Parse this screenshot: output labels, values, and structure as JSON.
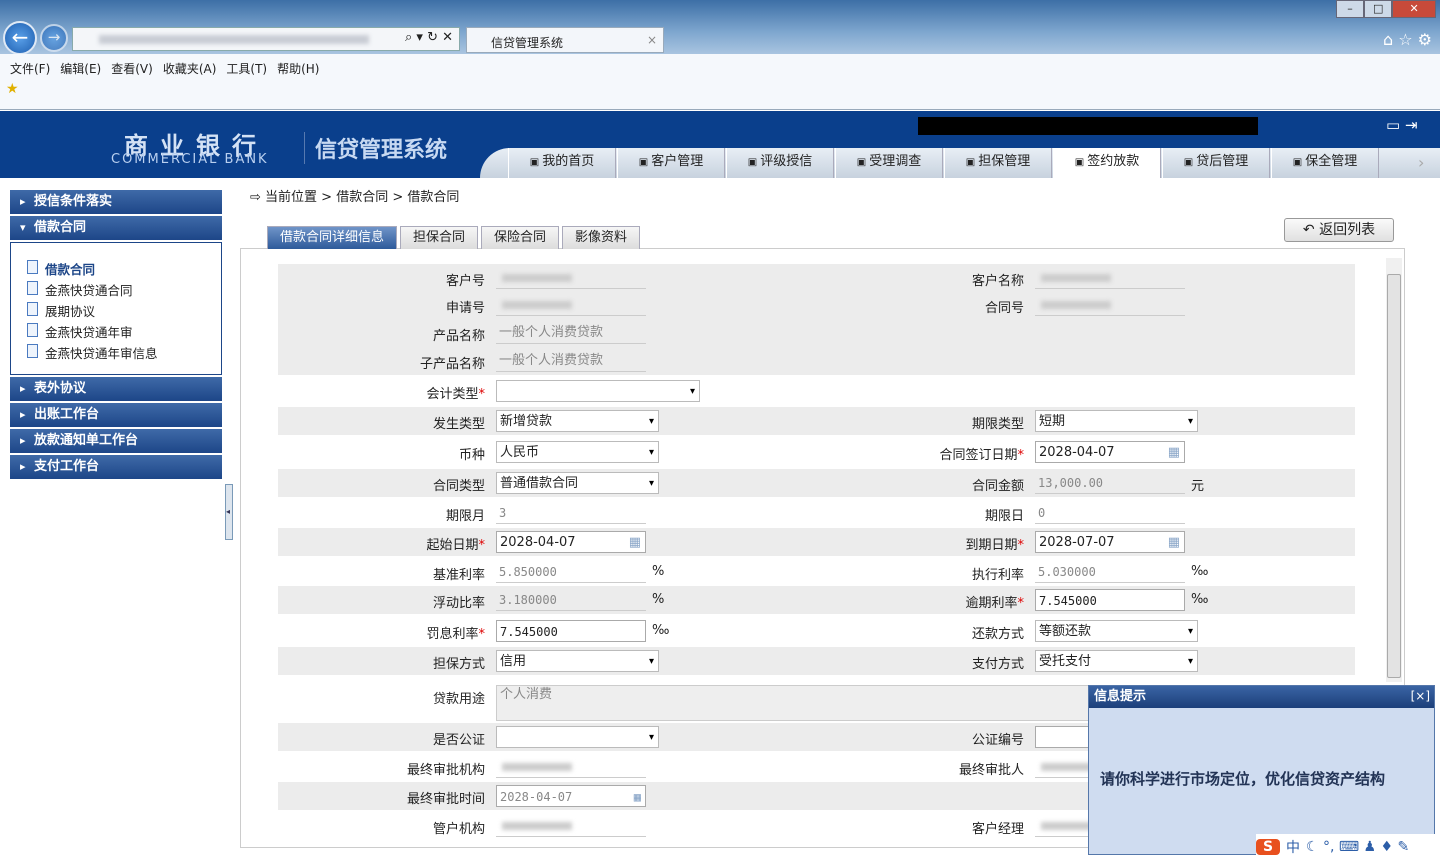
{
  "browser": {
    "tab_title": "信贷管理系统",
    "menu": [
      "文件(F)",
      "编辑(E)",
      "查看(V)",
      "收藏夹(A)",
      "工具(T)",
      "帮助(H)"
    ]
  },
  "header": {
    "bank_cn": "商业银行",
    "bank_en": "COMMERCIAL BANK",
    "system": "信贷管理系统"
  },
  "nav": [
    {
      "label": "我的首页",
      "icon": "home-icon"
    },
    {
      "label": "客户管理",
      "icon": "customer-icon"
    },
    {
      "label": "评级授信",
      "icon": "rating-icon"
    },
    {
      "label": "受理调查",
      "icon": "survey-icon"
    },
    {
      "label": "担保管理",
      "icon": "guarantee-icon"
    },
    {
      "label": "签约放款",
      "icon": "contract-icon",
      "active": true
    },
    {
      "label": "贷后管理",
      "icon": "postloan-icon"
    },
    {
      "label": "保全管理",
      "icon": "preserve-icon"
    }
  ],
  "sidebar": {
    "groups": [
      {
        "label": "授信条件落实"
      },
      {
        "label": "借款合同",
        "open": true,
        "items": [
          "借款合同",
          "金燕快贷通合同",
          "展期协议",
          "金燕快贷通年审",
          "金燕快贷通年审信息"
        ]
      },
      {
        "label": "表外协议"
      },
      {
        "label": "出账工作台"
      },
      {
        "label": "放款通知单工作台"
      },
      {
        "label": "支付工作台"
      }
    ]
  },
  "breadcrumb": "当前位置 > 借款合同 > 借款合同",
  "tabs": [
    "借款合同详细信息",
    "担保合同",
    "保险合同",
    "影像资料"
  ],
  "back_button": "返回列表",
  "form": [
    {
      "l": {
        "label": "客户号",
        "type": "blur"
      },
      "r": {
        "label": "客户名称",
        "type": "blur"
      }
    },
    {
      "l": {
        "label": "申请号",
        "type": "blur"
      },
      "r": {
        "label": "合同号",
        "type": "blur"
      }
    },
    {
      "l": {
        "label": "产品名称",
        "value": "一般个人消费贷款"
      }
    },
    {
      "l": {
        "label": "子产品名称",
        "value": "一般个人消费贷款"
      }
    },
    {
      "l": {
        "label": "会计类型",
        "req": true,
        "type": "sel",
        "value": ""
      }
    },
    {
      "l": {
        "label": "发生类型",
        "type": "sel",
        "value": "新增贷款"
      },
      "r": {
        "label": "期限类型",
        "type": "sel",
        "value": "短期"
      }
    },
    {
      "l": {
        "label": "币种",
        "type": "sel",
        "value": "人民币"
      },
      "r": {
        "label": "合同签订日期",
        "req": true,
        "type": "date",
        "value": "2028-04-07"
      }
    },
    {
      "l": {
        "label": "合同类型",
        "type": "sel",
        "value": "普通借款合同"
      },
      "r": {
        "label": "合同金额",
        "value": "13,000.00",
        "unit": "元",
        "mono": true
      }
    },
    {
      "l": {
        "label": "期限月",
        "value": "3",
        "mono": true
      },
      "r": {
        "label": "期限日",
        "value": "0",
        "mono": true
      }
    },
    {
      "l": {
        "label": "起始日期",
        "req": true,
        "type": "date",
        "value": "2028-04-07"
      },
      "r": {
        "label": "到期日期",
        "req": true,
        "type": "date",
        "value": "2028-07-07"
      }
    },
    {
      "l": {
        "label": "基准利率",
        "value": "5.850000",
        "unit": "%",
        "mono": true
      },
      "r": {
        "label": "执行利率",
        "value": "5.030000",
        "unit": "‰",
        "mono": true
      }
    },
    {
      "l": {
        "label": "浮动比率",
        "value": "3.180000",
        "unit": "%",
        "mono": true
      },
      "r": {
        "label": "逾期利率",
        "req": true,
        "type": "inp",
        "value": "7.545000",
        "unit": "‰",
        "mono": true
      }
    },
    {
      "l": {
        "label": "罚息利率",
        "req": true,
        "type": "inp",
        "value": "7.545000",
        "unit": "‰",
        "mono": true
      },
      "r": {
        "label": "还款方式",
        "type": "sel",
        "value": "等额还款"
      }
    },
    {
      "l": {
        "label": "担保方式",
        "type": "sel",
        "value": "信用"
      },
      "r": {
        "label": "支付方式",
        "type": "sel",
        "value": "受托支付"
      }
    },
    {
      "l": {
        "label": "贷款用途",
        "type": "area",
        "value": "个人消费"
      }
    },
    {
      "l": {
        "label": "是否公证",
        "type": "sel",
        "value": ""
      },
      "r": {
        "label": "公证编号",
        "type": "inp",
        "value": ""
      }
    },
    {
      "l": {
        "label": "最终审批机构",
        "type": "blur"
      },
      "r": {
        "label": "最终审批人",
        "type": "blur"
      }
    },
    {
      "l": {
        "label": "最终审批时间",
        "type": "date",
        "value": "2028-04-07",
        "mono": true,
        "ro": true
      }
    },
    {
      "l": {
        "label": "管户机构",
        "type": "blur"
      },
      "r": {
        "label": "客户经理",
        "type": "blur"
      }
    }
  ],
  "popup": {
    "title": "信息提示",
    "close": "[×]",
    "message": "请你科学进行市场定位，优化信贷资产结构"
  },
  "ime": {
    "lang": "中"
  }
}
